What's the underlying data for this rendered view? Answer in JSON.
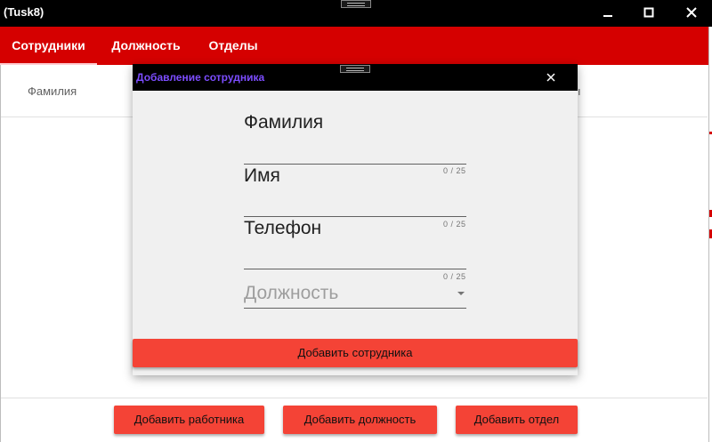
{
  "window": {
    "title": "(Tusk8)",
    "minimize_icon": "minimize-icon",
    "maximize_icon": "maximize-icon",
    "close_icon": "close-icon"
  },
  "nav": {
    "tabs": [
      {
        "label": "Сотрудники",
        "active": true
      },
      {
        "label": "Должность",
        "active": false
      },
      {
        "label": "Отделы",
        "active": false
      }
    ],
    "background": "#d50000"
  },
  "table": {
    "columns": [
      "Фамилия",
      "ı"
    ]
  },
  "actions": {
    "add_worker": "Добавить работника",
    "add_position": "Добавить должность",
    "add_department": "Добавить отдел"
  },
  "dialog": {
    "title": "Добавление сотрудника",
    "fields": [
      {
        "label": "Фамилия",
        "counter": "0 / 25"
      },
      {
        "label": "Имя",
        "counter": "0 / 25"
      },
      {
        "label": "Телефон",
        "counter": "0 / 25"
      }
    ],
    "select": {
      "placeholder": "Должность"
    },
    "submit_label": "Добавить сотрудника"
  },
  "colors": {
    "accent": "#f44336",
    "brand": "#d50000",
    "dialog_title": "#7c4dff"
  }
}
